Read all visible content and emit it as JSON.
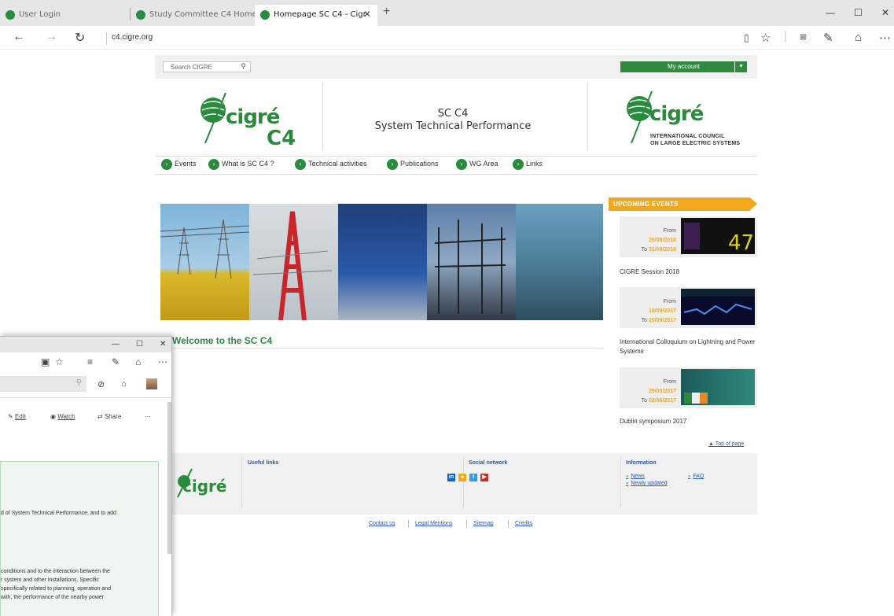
{
  "browser": {
    "tabs": [
      {
        "title": "User Login"
      },
      {
        "title": "Study Committee C4 Home"
      },
      {
        "title": "Homepage SC C4 - Cigr"
      }
    ],
    "new_tab": "+",
    "close_tab": "✕",
    "url": "c4.cigre.org",
    "controls": {
      "minimize": "—",
      "maximize": "☐",
      "close": "✕"
    },
    "toolbar_icons": [
      "reading-view-icon",
      "favorites-star-icon",
      "hub-icon",
      "web-note-icon",
      "share-icon",
      "more-icon"
    ]
  },
  "site": {
    "search_placeholder": "Search CIGRE",
    "my_account": "My account",
    "logo_left": {
      "word": "cigré",
      "sub": "C4"
    },
    "title_line1": "SC C4",
    "title_line2": "System Technical Performance",
    "logo_right": {
      "word": "cigré",
      "line1": "INTERNATIONAL COUNCIL",
      "line2": "ON LARGE ELECTRIC SYSTEMS"
    },
    "menu": [
      "Events",
      "What is SC C4 ?",
      "Technical activities",
      "Publications",
      "WG Area",
      "Links"
    ],
    "welcome": "Welcome to the SC C4",
    "upcoming_events": {
      "heading": "UPCOMING EVENTS",
      "items": [
        {
          "from_label": "From",
          "from": "26/08/2018",
          "to_label": "To",
          "to": "31/08/2018",
          "title": "CIGRE Session 2018"
        },
        {
          "from_label": "From",
          "from": "18/09/2017",
          "to_label": "To",
          "to": "20/09/2017",
          "title": "International Colloquium on Lightning and Power Systems"
        },
        {
          "from_label": "From",
          "from": "29/05/2017",
          "to_label": "To",
          "to": "02/06/2017",
          "title": "Dublin symposium 2017"
        }
      ]
    },
    "top_of_page": "Top of page",
    "footer": {
      "logo": "cigré",
      "useful_links": "Useful links",
      "social_network": "Social network",
      "information": "Information",
      "info_links": [
        "News",
        "Newly updated",
        "FAQ"
      ]
    },
    "bottom_links": [
      "Contact us",
      "Legal Mentions",
      "Sitemap",
      "Credits"
    ]
  },
  "second_window": {
    "controls": {
      "minimize": "—",
      "maximize": "☐",
      "close": "✕"
    },
    "actions": [
      "Edit",
      "Watch",
      "Share",
      "···"
    ],
    "text_lines": [
      "d of System Technical Performance, and to add",
      "conditions and to the interaction between the",
      "r system and other installations. Specific",
      " specifically related to planning, operation and",
      " with, the performance of the nearby power"
    ]
  },
  "colors": {
    "brand_green": "#2a8a3e",
    "accent_orange": "#f2a81d",
    "link_blue": "#2a5aa8"
  }
}
